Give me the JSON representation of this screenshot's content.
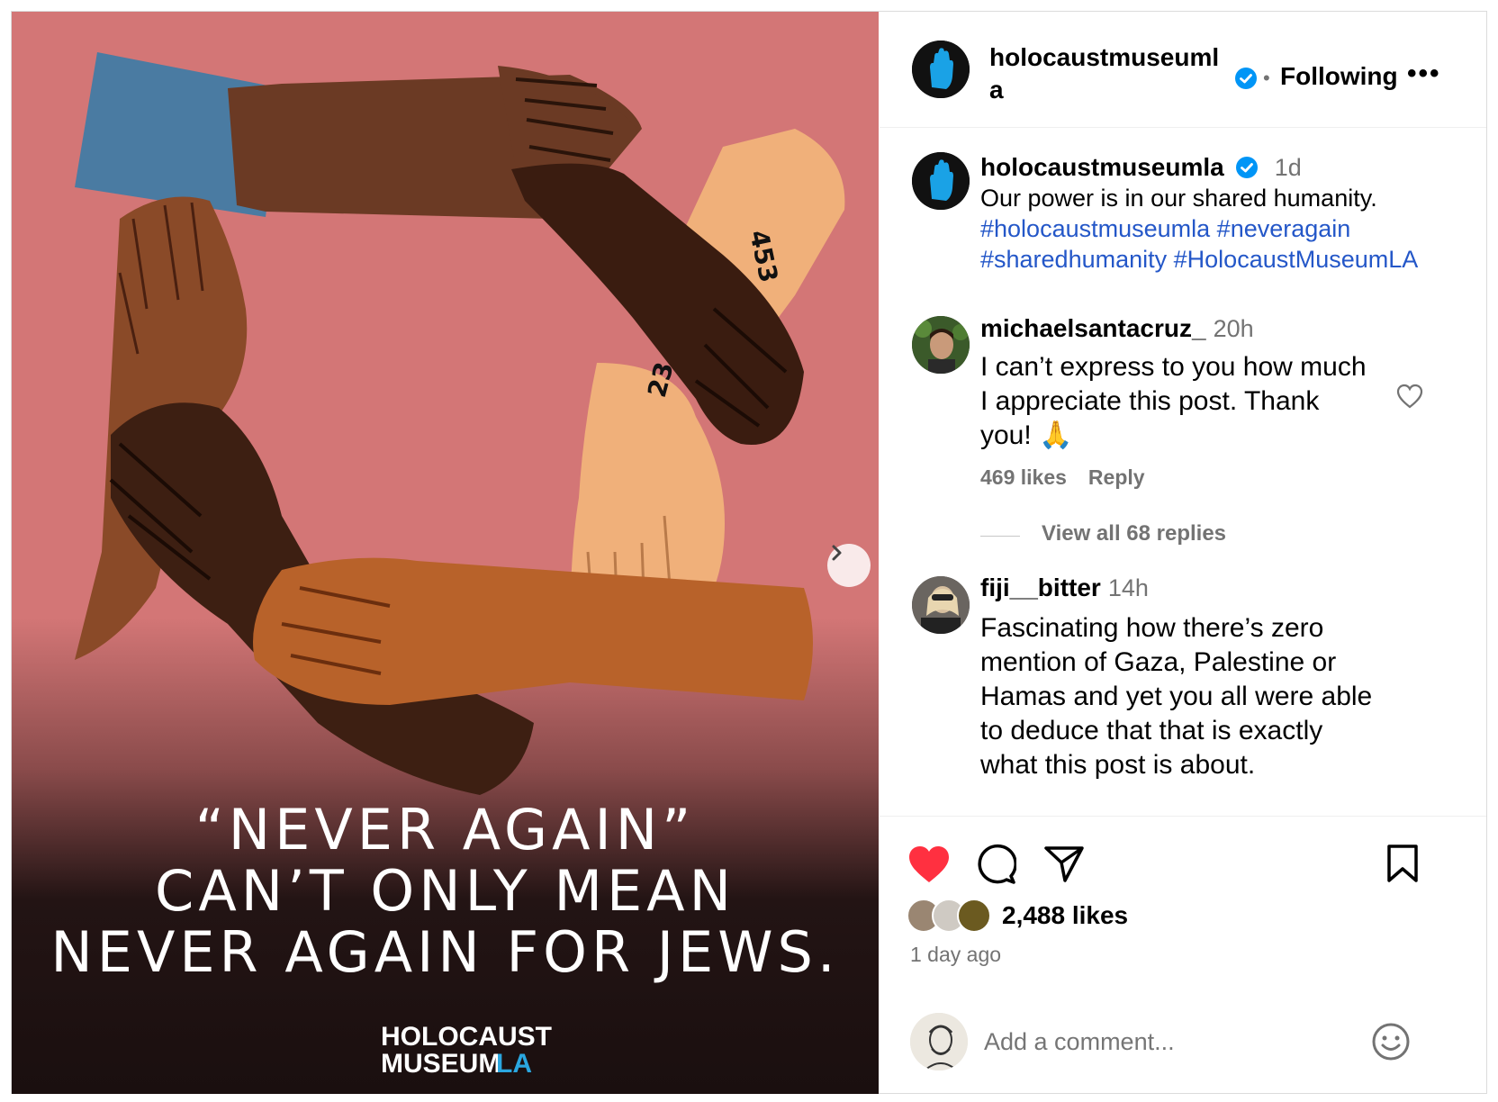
{
  "post_image": {
    "arm_numbers": [
      "453",
      "23"
    ],
    "headline": [
      "“NEVER AGAIN”",
      "CAN’T ONLY MEAN",
      "NEVER AGAIN FOR JEWS."
    ],
    "logo_text": [
      "HOLOCAUST",
      "MUSEUM",
      "LA"
    ],
    "next_icon": "chevron-right-icon"
  },
  "header": {
    "username": "holocaustmuseumla",
    "separator": "•",
    "following_label": "Following",
    "more_label": "•••"
  },
  "caption": {
    "username": "holocaustmuseumla",
    "time": "1d",
    "text": "Our power is in our shared humanity.",
    "hashtags": [
      "#holocaustmuseumla",
      "#neveragain",
      "#sharedhumanity",
      "#HolocaustMuseumLA"
    ]
  },
  "comments": [
    {
      "username": "michaelsantacruz_",
      "time": "20h",
      "lines": [
        "I can’t express to you how much",
        "I appreciate this post. Thank",
        "you! 🙏"
      ],
      "likes": "469 likes",
      "reply_label": "Reply",
      "view_replies": "View all 68 replies"
    },
    {
      "username": "fiji__bitter",
      "time": "14h",
      "lines": [
        "Fascinating how there’s zero",
        "mention of Gaza, Palestine or",
        "Hamas and yet you all were able",
        "to deduce that that is exactly",
        "what this post is about."
      ]
    }
  ],
  "actions": {
    "likes": "2,488 likes",
    "age": "1 day ago"
  },
  "add_comment": {
    "placeholder": "Add a comment..."
  },
  "colors": {
    "poster_background": "#d37676",
    "poster_dark": "#1a0f0f",
    "heart": "#ff3040",
    "link": "#2457c8",
    "verified": "#0095f6"
  }
}
